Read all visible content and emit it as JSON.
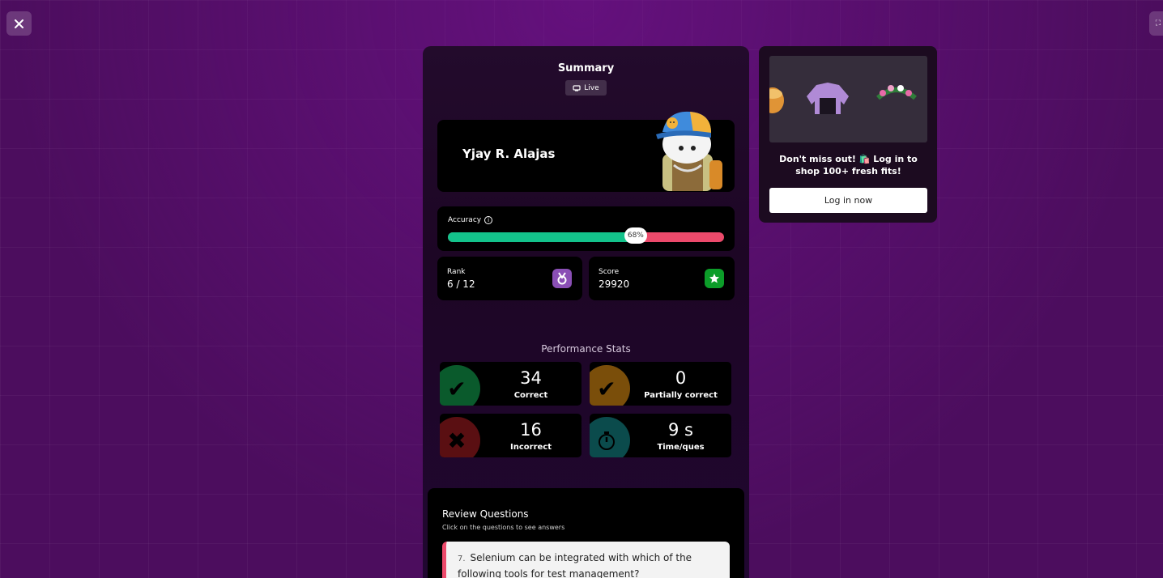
{
  "window": {
    "close_icon": "close-icon",
    "expand_icon": "expand-icon"
  },
  "summary": {
    "title": "Summary",
    "mode_badge": "Live",
    "player_name": "Yjay R. Alajas",
    "accuracy": {
      "label": "Accuracy",
      "value_text": "68%",
      "value": 0.68,
      "correct_color": "#13c38b",
      "incorrect_color": "#ec4a6b"
    },
    "rank": {
      "label": "Rank",
      "value": "6 / 12",
      "icon": "medal-icon",
      "icon_color": "#8a4fb5"
    },
    "score": {
      "label": "Score",
      "value": "29920",
      "icon": "star-icon",
      "icon_color": "#0c9d29"
    }
  },
  "performance": {
    "title": "Performance Stats",
    "items": [
      {
        "value": "34",
        "label": "Correct",
        "icon": "check-icon",
        "color": "#0a5a2c"
      },
      {
        "value": "0",
        "label": "Partially correct",
        "icon": "check-icon",
        "color": "#7a4e0a"
      },
      {
        "value": "16",
        "label": "Incorrect",
        "icon": "cross-icon",
        "color": "#5a0f12"
      },
      {
        "value": "9 s",
        "label": "Time/ques",
        "icon": "stopwatch-icon",
        "color": "#0b4b4c"
      }
    ]
  },
  "review": {
    "title": "Review Questions",
    "subtitle": "Click on the questions to see answers",
    "questions": [
      {
        "number": "7.",
        "text": "Selenium can be integrated with which of the following tools for test management?"
      }
    ]
  },
  "promo": {
    "text": "Don't miss out! 🛍️ Log in to shop 100+ fresh fits!",
    "button_label": "Log in now"
  }
}
